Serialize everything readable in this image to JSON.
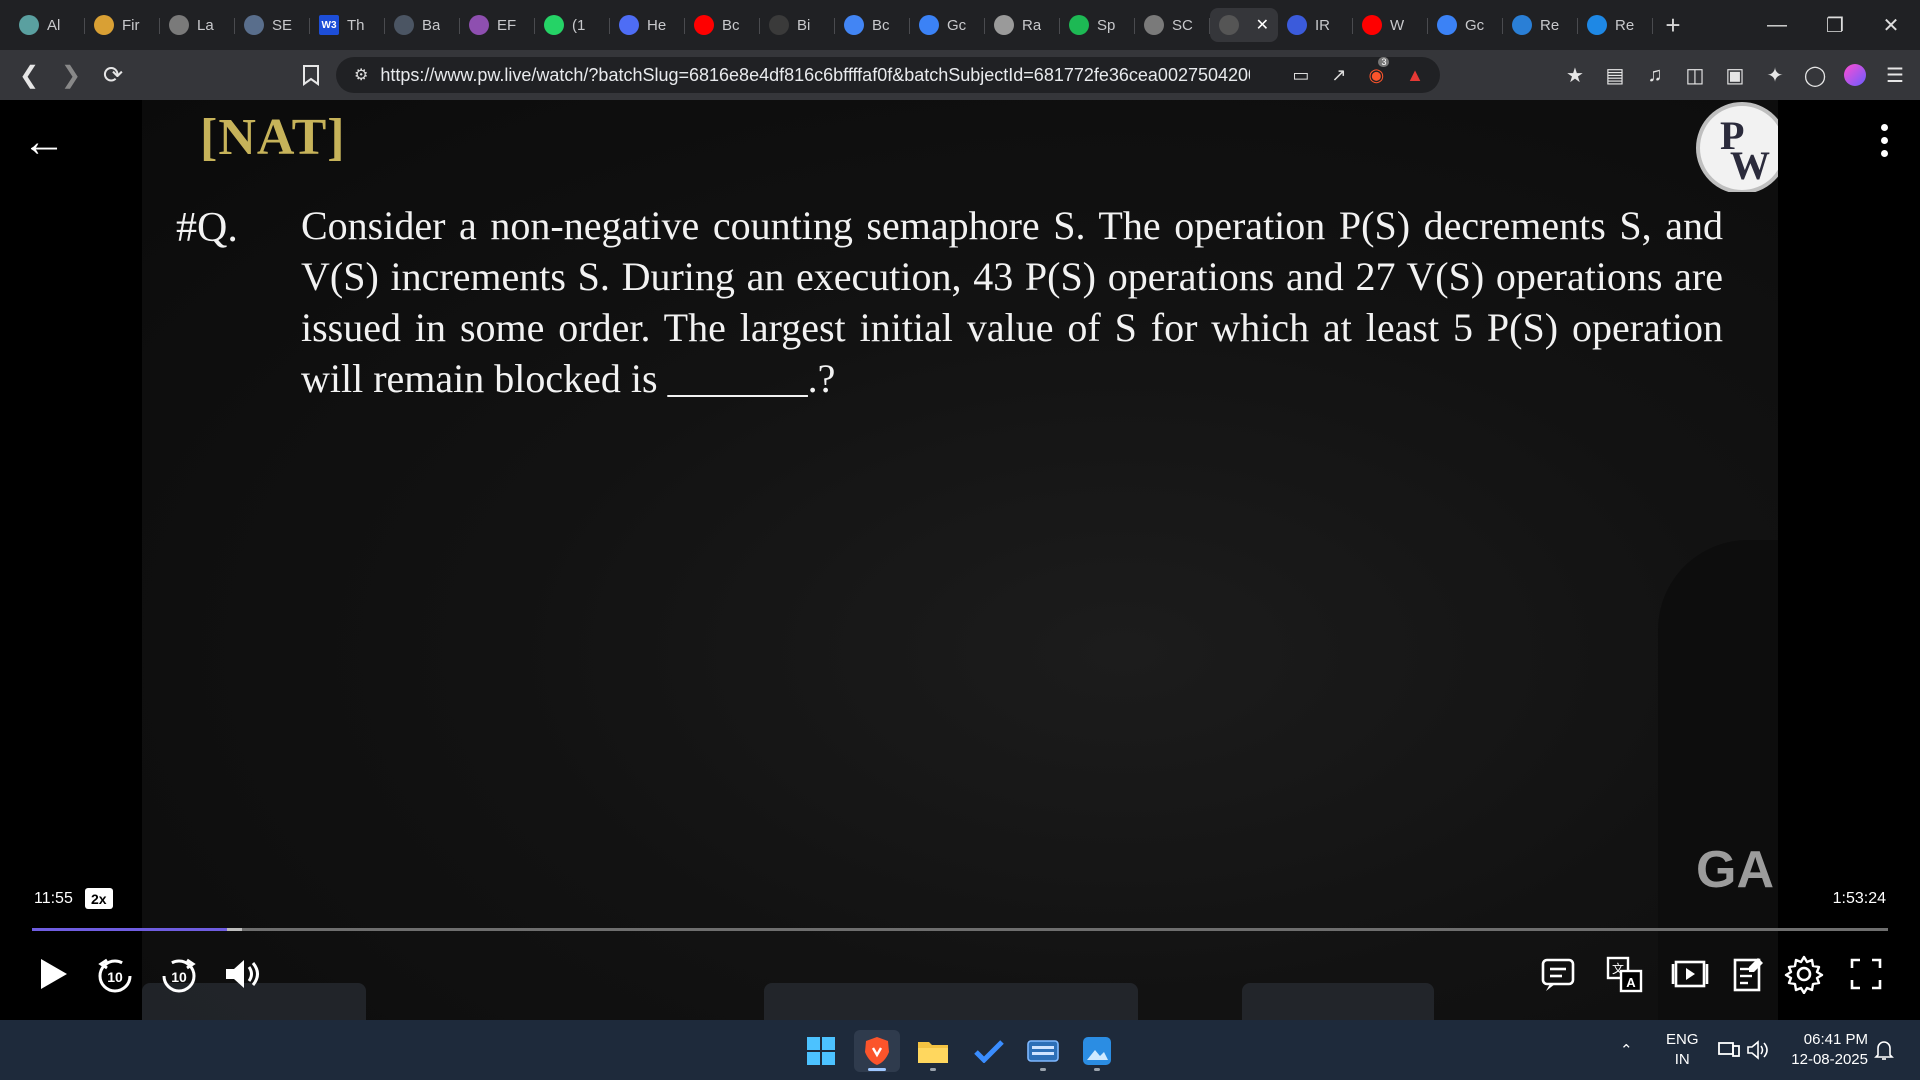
{
  "browser": {
    "tabs": [
      {
        "label": "Al",
        "color": "#5aa0a0"
      },
      {
        "label": "Fir",
        "color": "#d9a034"
      },
      {
        "label": "La",
        "color": "#7a7a7a"
      },
      {
        "label": "SE",
        "color": "#596e8c"
      },
      {
        "label": "Th",
        "color": "#1d4ed8",
        "fav_text": "W3"
      },
      {
        "label": "Ba",
        "color": "#4b5563"
      },
      {
        "label": "EF",
        "color": "#8e4fb0"
      },
      {
        "label": "(1",
        "color": "#25d366"
      },
      {
        "label": "He",
        "color": "#4e6df5"
      },
      {
        "label": "Bc",
        "color": "#ff0000"
      },
      {
        "label": "Bi",
        "color": "#3a3a3a"
      },
      {
        "label": "Bc",
        "color": "#4285f4"
      },
      {
        "label": "Gc",
        "color": "#3b82f6"
      },
      {
        "label": "Ra",
        "color": "#9a9a9a"
      },
      {
        "label": "Sp",
        "color": "#1db954"
      },
      {
        "label": "SC",
        "color": "#7a7a7a"
      },
      {
        "label": "",
        "color": "#555",
        "active": true
      },
      {
        "label": "IR",
        "color": "#3b5bdb"
      },
      {
        "label": "W",
        "color": "#ff0000"
      },
      {
        "label": "Gc",
        "color": "#3b82f6"
      },
      {
        "label": "Re",
        "color": "#2a7fd6"
      },
      {
        "label": "Re",
        "color": "#1e88e5"
      }
    ],
    "url": "https://www.pw.live/watch/?batchSlug=6816e8e4df816c6bffffaf0f&batchSubjectId=681772fe36cea0027504200...",
    "shield_badge": "3"
  },
  "lecture": {
    "tag": "[NAT]",
    "question_label": "#Q.",
    "question_text": "Consider a non-negative counting semaphore S. The operation P(S) decrements S, and V(S) increments S. During an execution, 43 P(S) operations and 27 V(S) operations are issued in some order. The largest initial value of S for which at least 5 P(S) operation will remain blocked is _______.?",
    "logo_letters": [
      "P",
      "W"
    ],
    "overlay_text": "GA"
  },
  "player": {
    "current_time": "11:55",
    "speed": "2x",
    "total_time": "1:53:24",
    "progress_fraction": 0.105,
    "buffered_fraction": 0.113,
    "skip_seconds": "10"
  },
  "taskbar": {
    "language": "ENG",
    "region": "IN",
    "time": "06:41 PM",
    "date": "12-08-2025"
  }
}
